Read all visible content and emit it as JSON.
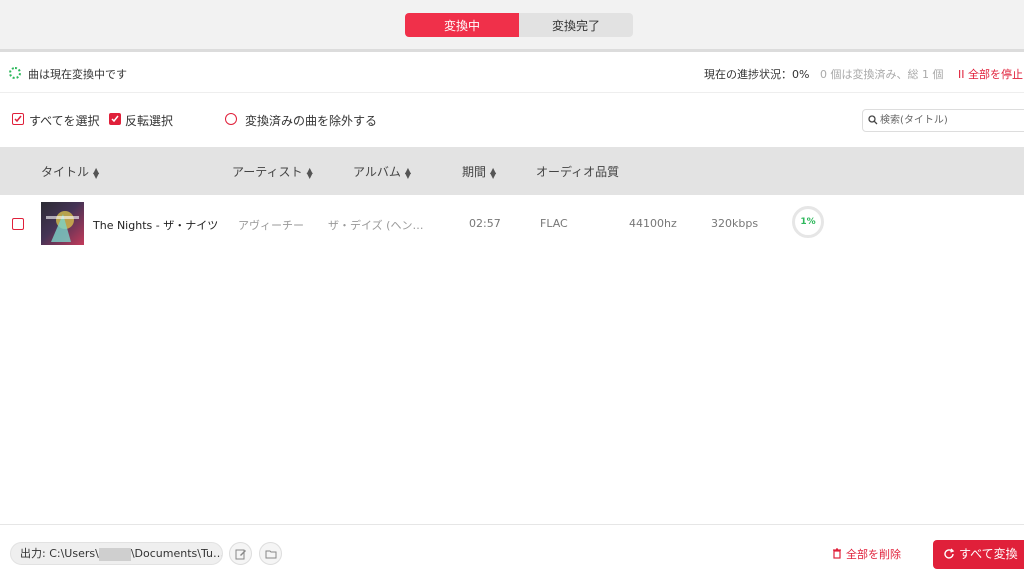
{
  "tabs": {
    "converting": "変換中",
    "completed": "変換完了"
  },
  "status": {
    "message": "曲は現在変換中です",
    "progress_label": "現在の進捗状況：0%",
    "progress_info": "0 個は変換済み、総 1 個",
    "stop_all": "II  全部を停止"
  },
  "toolbar": {
    "select_all": "すべてを選択",
    "invert_selection": "反転選択",
    "exclude_converted": "変換済みの曲を除外する",
    "search_placeholder": "検索(タイトル)"
  },
  "table": {
    "headers": {
      "title": "タイトル",
      "artist": "アーティスト",
      "album": "アルバム",
      "duration": "期間",
      "audio_quality": "オーディオ品質"
    },
    "rows": [
      {
        "title": "The Nights - ザ・ナイツ",
        "artist": "アヴィーチー",
        "album": "ザ・デイズ (ヘン…",
        "duration": "02:57",
        "format": "FLAC",
        "sample_rate": "44100hz",
        "bitrate": "320kbps",
        "progress": "1%"
      }
    ]
  },
  "footer": {
    "output_prefix": "出力: C:\\Users\\",
    "output_suffix": "\\Documents\\Tu…",
    "delete_all": "全部を削除",
    "convert_all": "すべて変換"
  },
  "colors": {
    "accent": "#e0203a",
    "active_tab": "#f0304a",
    "progress_green": "#2eb85c"
  },
  "icons": [
    "spinner-icon",
    "checkbox-icon",
    "radio-icon",
    "search-icon",
    "sort-icon",
    "edit-icon",
    "folder-icon",
    "trash-icon",
    "refresh-icon"
  ]
}
